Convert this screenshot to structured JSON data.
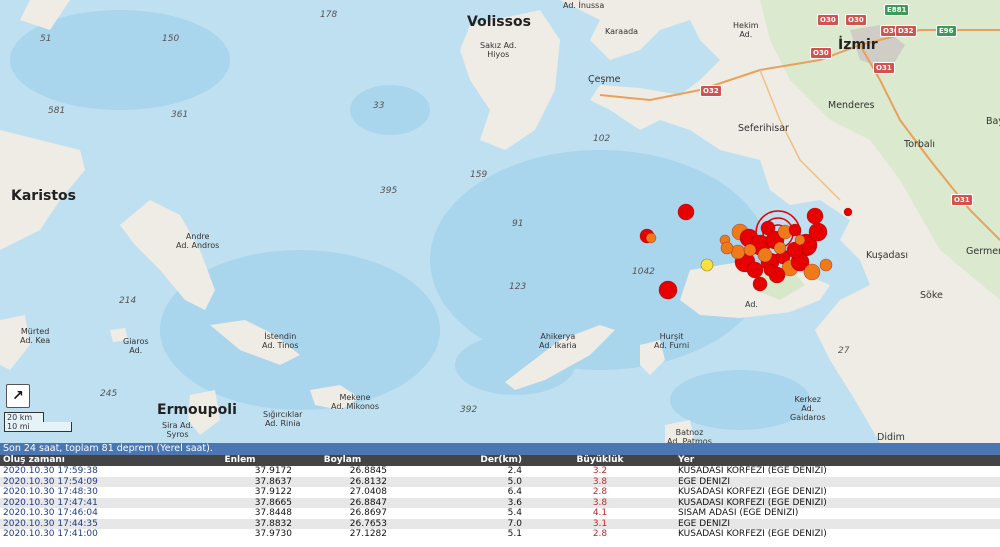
{
  "map": {
    "cities": [
      {
        "id": "volissos",
        "name": "Volissos"
      },
      {
        "id": "izmir",
        "name": "İzmir"
      },
      {
        "id": "karistos",
        "name": "Karistos"
      },
      {
        "id": "ermoupoli",
        "name": "Ermoupoli"
      }
    ],
    "towns": [
      {
        "id": "cesme",
        "name": "Çeşme"
      },
      {
        "id": "seferihisar",
        "name": "Seferihisar"
      },
      {
        "id": "menderes",
        "name": "Menderes"
      },
      {
        "id": "torbali",
        "name": "Torbalı"
      },
      {
        "id": "kusadasi",
        "name": "Kuşadası"
      },
      {
        "id": "soke",
        "name": "Söke"
      },
      {
        "id": "didim",
        "name": "Didim"
      },
      {
        "id": "germencik",
        "name": "Germen"
      },
      {
        "id": "bay",
        "name": "Bay"
      }
    ],
    "islands": [
      {
        "id": "sakiz",
        "name": "Sakız Ad.\nHiyos"
      },
      {
        "id": "inussa",
        "name": "Ad. İnussa"
      },
      {
        "id": "karaada",
        "name": "Karaada"
      },
      {
        "id": "hekim",
        "name": "Hekim\nAd."
      },
      {
        "id": "andros",
        "name": "Andre\nAd. Andros"
      },
      {
        "id": "murted",
        "name": "Mürted\nAd. Kea"
      },
      {
        "id": "giaros",
        "name": "Giaros\nAd."
      },
      {
        "id": "tinos",
        "name": "İstendin\nAd. Tinos"
      },
      {
        "id": "mikonos",
        "name": "Mekene\nAd. Mikonos"
      },
      {
        "id": "rinia",
        "name": "Sığırcıklar\nAd. Rinia"
      },
      {
        "id": "syros",
        "name": "Sira Ad.\nSyros"
      },
      {
        "id": "ikaria",
        "name": "Ahikerya\nAd. Ikaria"
      },
      {
        "id": "furni",
        "name": "Hurşit\nAd. Furni"
      },
      {
        "id": "batnoz",
        "name": "Batnoz\nAd. Patmos"
      },
      {
        "id": "gaidaros",
        "name": "Kerkez\nAd.\nGaidaros"
      },
      {
        "id": "sisam",
        "name": "Ad."
      }
    ],
    "depths": [
      {
        "id": "d178",
        "value": "178"
      },
      {
        "id": "d51",
        "value": "51"
      },
      {
        "id": "d150",
        "value": "150"
      },
      {
        "id": "d581",
        "value": "581"
      },
      {
        "id": "d361",
        "value": "361"
      },
      {
        "id": "d33",
        "value": "33"
      },
      {
        "id": "d102",
        "value": "102"
      },
      {
        "id": "d395",
        "value": "395"
      },
      {
        "id": "d159",
        "value": "159"
      },
      {
        "id": "d91",
        "value": "91"
      },
      {
        "id": "d1042",
        "value": "1042"
      },
      {
        "id": "d123",
        "value": "123"
      },
      {
        "id": "d214",
        "value": "214"
      },
      {
        "id": "d245",
        "value": "245"
      },
      {
        "id": "d392",
        "value": "392"
      },
      {
        "id": "d27",
        "value": "27"
      }
    ],
    "roads": [
      {
        "id": "r1",
        "label": "O30",
        "color": "#d0534f"
      },
      {
        "id": "r2",
        "label": "O30",
        "color": "#d0534f"
      },
      {
        "id": "r3",
        "label": "E881",
        "color": "#3d9b56"
      },
      {
        "id": "r4",
        "label": "O30",
        "color": "#d0534f"
      },
      {
        "id": "r5",
        "label": "D32",
        "color": "#d0534f"
      },
      {
        "id": "r6",
        "label": "E96",
        "color": "#3d9b56"
      },
      {
        "id": "r7",
        "label": "O30",
        "color": "#d0534f"
      },
      {
        "id": "r8",
        "label": "O31",
        "color": "#d0534f"
      },
      {
        "id": "r9",
        "label": "O32",
        "color": "#d0534f"
      },
      {
        "id": "r10",
        "label": "O31",
        "color": "#d0534f"
      }
    ],
    "scale": {
      "km": "20 km",
      "mi": "10 mi"
    },
    "expand_icon": "arrow-expand-icon",
    "colors": {
      "sea": "#bfe0f0",
      "deep_sea": "#a8d4ec",
      "land": "#f2efe9",
      "green": "#d6e8c9",
      "quake_red": "#e60000",
      "quake_orange": "#f07a1a",
      "quake_yellow": "#f5e23a"
    }
  },
  "earthquakes_summary": "Son 24 saat, toplam 81 deprem (Yerel saat).",
  "table": {
    "headers": [
      "Oluş zamanı",
      "Enlem",
      "Boylam",
      "Der(km)",
      "Büyüklük",
      "Yer"
    ],
    "rows": [
      [
        "2020.10.30 17:59:38",
        "37.9172",
        "26.8845",
        "2.4",
        "3.2",
        "KUSADASI KORFEZI (EGE DENIZI)"
      ],
      [
        "2020.10.30 17:54:09",
        "37.8637",
        "26.8132",
        "5.0",
        "3.8",
        "EGE DENIZI"
      ],
      [
        "2020.10.30 17:48:30",
        "37.9122",
        "27.0408",
        "6.4",
        "2.8",
        "KUSADASI KORFEZI (EGE DENIZI)"
      ],
      [
        "2020.10.30 17:47:41",
        "37.8665",
        "26.8847",
        "3.6",
        "3.8",
        "KUSADASI KORFEZI (EGE DENIZI)"
      ],
      [
        "2020.10.30 17:46:04",
        "37.8448",
        "26.8697",
        "5.4",
        "4.1",
        "SISAM ADASI (EGE DENIZI)"
      ],
      [
        "2020.10.30 17:44:35",
        "37.8832",
        "26.7653",
        "7.0",
        "3.1",
        "EGE DENIZI"
      ],
      [
        "2020.10.30 17:41:00",
        "37.9730",
        "27.1282",
        "5.1",
        "2.8",
        "KUSADASI KORFEZI (EGE DENIZI)"
      ]
    ]
  }
}
